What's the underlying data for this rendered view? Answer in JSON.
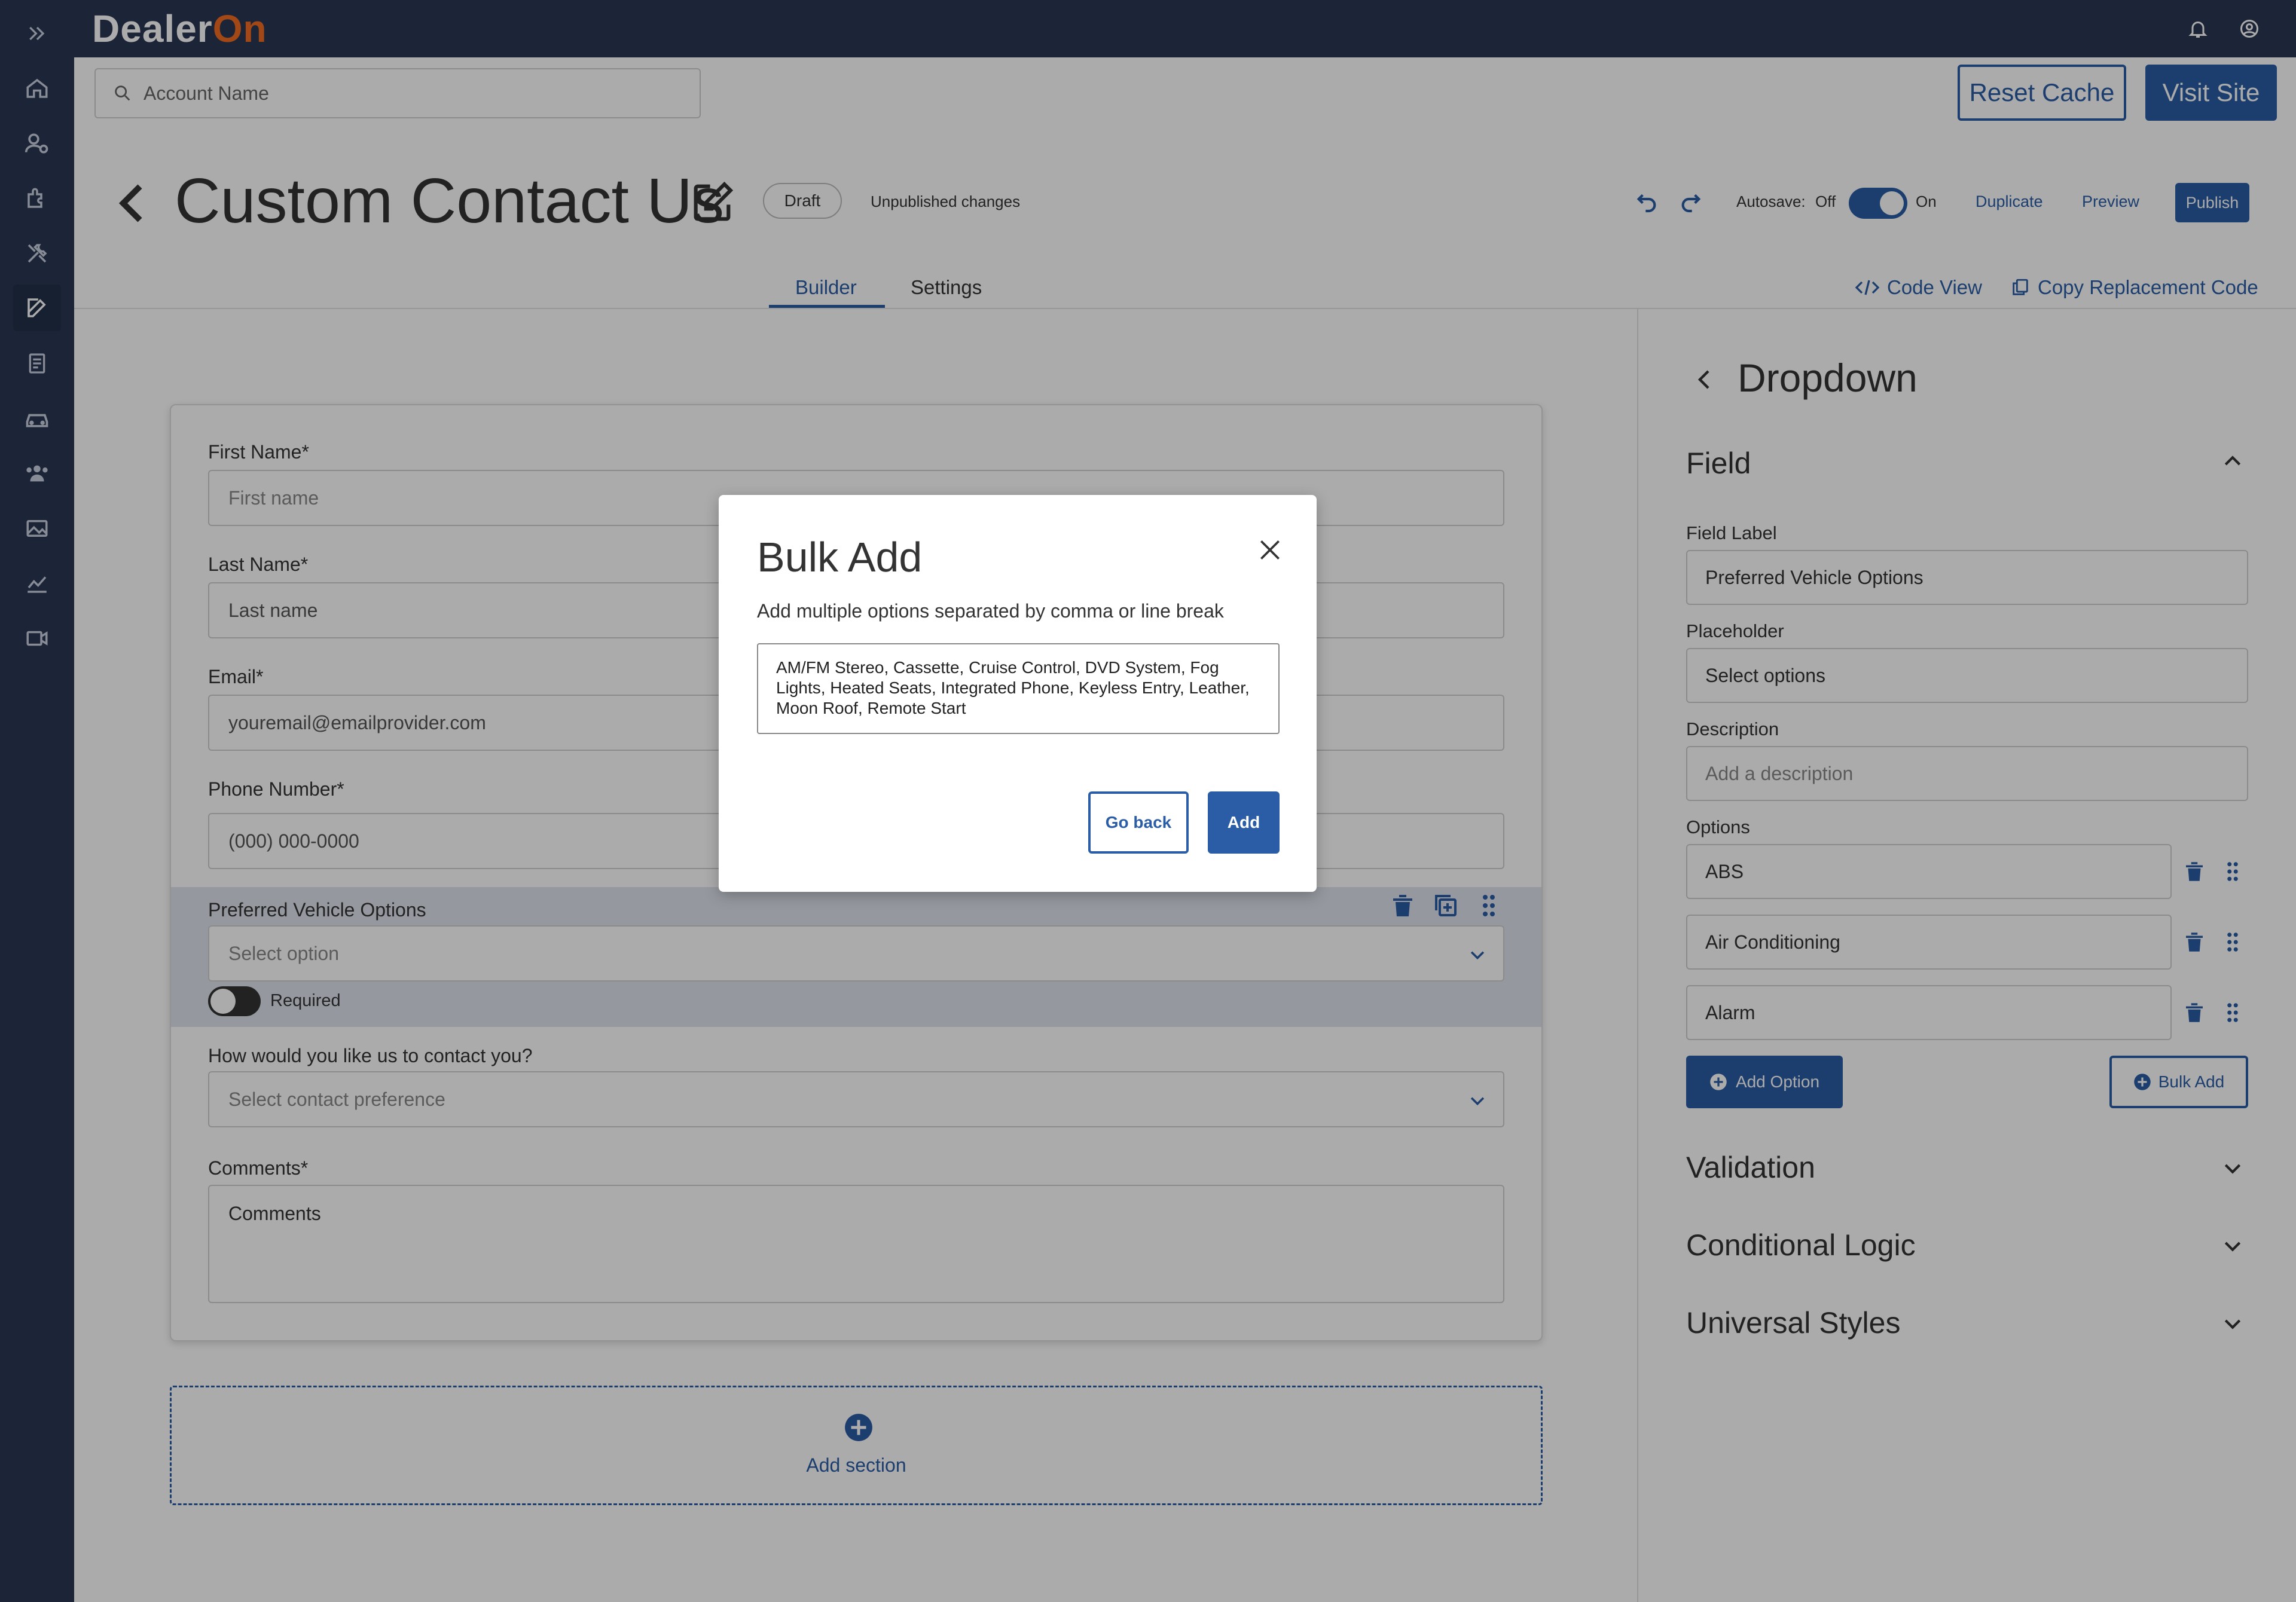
{
  "brand": {
    "logo_prefix": "Dealer",
    "logo_suffix": "On"
  },
  "colors": {
    "navy": "#2b3852",
    "primary": "#2b5da6",
    "logo_accent": "#f26b21"
  },
  "sidebar": {
    "icons": [
      "expand-icon",
      "home-icon",
      "user-settings-icon",
      "plugin-icon",
      "tools-icon",
      "edit-icon",
      "document-icon",
      "car-icon",
      "users-icon",
      "image-icon",
      "chart-icon",
      "video-icon"
    ]
  },
  "topbar": {
    "icons": [
      "bell-icon",
      "user-circle-icon"
    ]
  },
  "account": {
    "search_placeholder": "Account Name",
    "reset_cache": "Reset Cache",
    "visit_site": "Visit Site"
  },
  "header": {
    "title": "Custom Contact Us",
    "status": "Draft",
    "unpublished": "Unpublished changes",
    "autosave_label": "Autosave:",
    "autosave_off": "Off",
    "autosave_on": "On",
    "autosave_enabled": true,
    "duplicate": "Duplicate",
    "preview": "Preview",
    "publish": "Publish"
  },
  "tabs": [
    {
      "label": "Builder",
      "active": true
    },
    {
      "label": "Settings",
      "active": false
    }
  ],
  "code_view": "Code View",
  "copy_code": "Copy Replacement Code",
  "form": {
    "fields": [
      {
        "label": "First Name*",
        "placeholder": "First name"
      },
      {
        "label": "Last Name*",
        "placeholder": "Last name"
      },
      {
        "label": "Email*",
        "value": "youremail@emailprovider.com"
      },
      {
        "label": "Phone Number*",
        "value": "(000) 000-0000"
      }
    ],
    "dropdown": {
      "label": "Preferred Vehicle Options",
      "placeholder": "Select option",
      "required_label": "Required",
      "required": false
    },
    "contact": {
      "label": "How would you like us to contact you?",
      "placeholder": "Select contact preference"
    },
    "comments": {
      "label": "Comments*",
      "value": "Comments"
    },
    "add_section": "Add section"
  },
  "panel": {
    "title": "Dropdown",
    "field_section": "Field",
    "field_label_label": "Field Label",
    "field_label_value": "Preferred Vehicle Options",
    "placeholder_label": "Placeholder",
    "placeholder_value": "Select options",
    "description_label": "Description",
    "description_placeholder": "Add a description",
    "options_label": "Options",
    "options": [
      "ABS",
      "Air Conditioning",
      "Alarm"
    ],
    "add_option": "Add Option",
    "bulk_add": "Bulk Add",
    "validation": "Validation",
    "conditional_logic": "Conditional Logic",
    "universal_styles": "Universal Styles"
  },
  "modal": {
    "title": "Bulk Add",
    "subtitle": "Add multiple options separated by comma or line break",
    "text_line1": "AM/FM Stereo, Cassette, Cruise Control, DVD System, Fog",
    "text_line2": "Lights, Heated Seats, Integrated Phone, Keyless Entry, Leather,",
    "text_line3": "Moon Roof, Remote Start",
    "go_back": "Go back",
    "add": "Add"
  }
}
